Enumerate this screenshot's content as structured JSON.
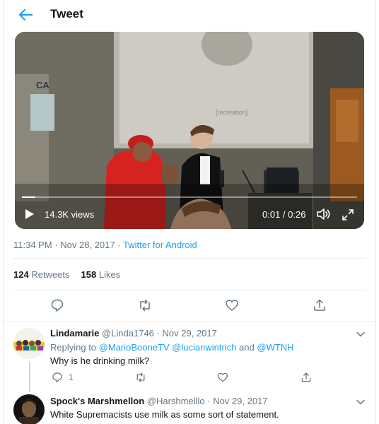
{
  "header": {
    "title": "Tweet"
  },
  "video": {
    "views": "14.3K views",
    "time": "0:01 / 0:26",
    "progress": 0.04,
    "scene_text": {
      "sign_top": "CA",
      "sign_box": "CA\nE",
      "screen_caption": "[recreation]"
    }
  },
  "tweet": {
    "time": "11:34 PM",
    "date": "Nov 28, 2017",
    "sep": "·",
    "source": "Twitter for Android",
    "retweets_count": "124",
    "retweets_label": "Retweets",
    "likes_count": "158",
    "likes_label": "Likes"
  },
  "replies": [
    {
      "name": "Lindamarie",
      "handle": "@Linda1746",
      "date": "Nov 29, 2017",
      "replying_prefix": "Replying to",
      "mentions": "@MarioBooneTV @lucianwintrich",
      "and": "and",
      "last_mention": "@WTNH",
      "text": "Why is he drinking milk?",
      "reply_count": "1"
    },
    {
      "name": "Spock's Marshmellon",
      "handle": "@Harshmelllo",
      "date": "Nov 29, 2017",
      "text": "White Supremacists use milk as some sort of statement."
    }
  ],
  "colors": {
    "accent": "#1da1f2",
    "muted": "#657786",
    "text": "#14171a",
    "border": "#e6ecf0"
  },
  "icons": [
    "back-arrow-icon",
    "play-icon",
    "volume-icon",
    "fullscreen-icon",
    "reply-icon",
    "retweet-icon",
    "like-icon",
    "share-icon",
    "chevron-down-icon"
  ]
}
